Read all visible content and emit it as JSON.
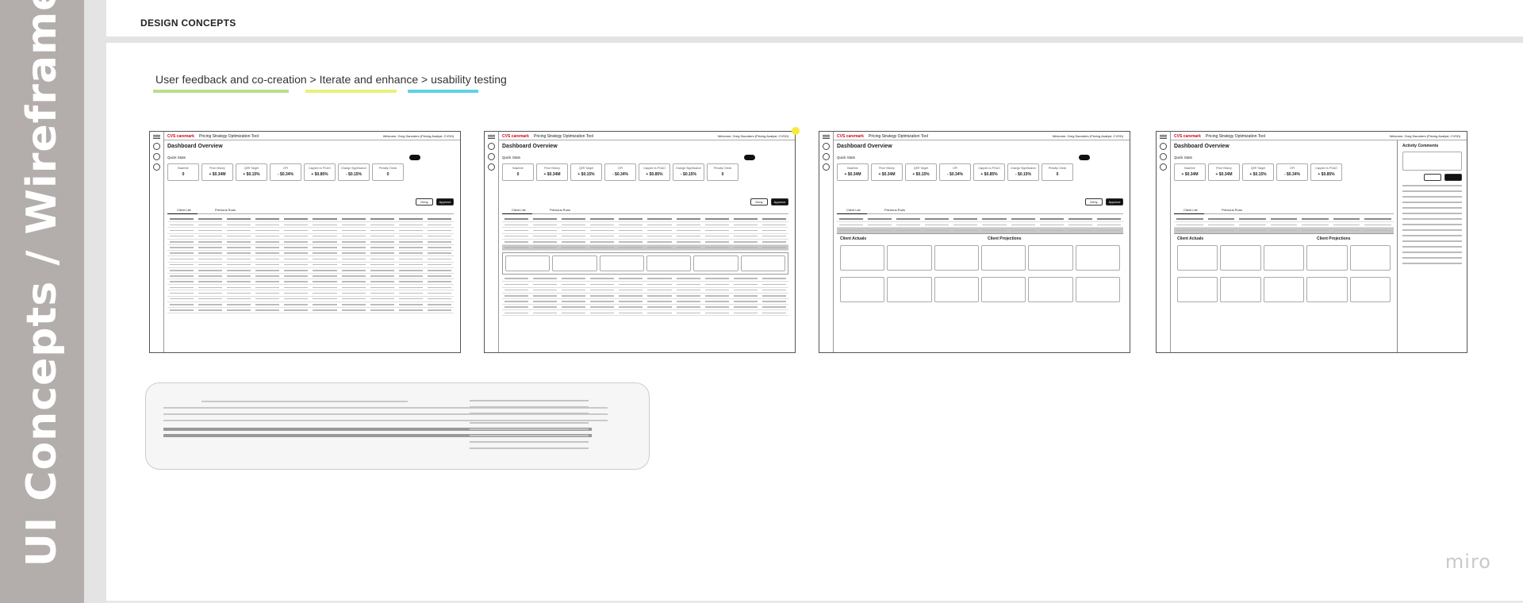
{
  "sidebar": {
    "title": "UI Concepts / Wireframes"
  },
  "header": {
    "title": "DESIGN CONCEPTS"
  },
  "process": {
    "text": "User feedback and co-creation > Iterate and enhance > usability testing",
    "colors": [
      "#b7e08a",
      "#e8f07a",
      "#5fd2e6"
    ]
  },
  "wireframe": {
    "logo": "CVS caremark",
    "app_title": "Pricing Strategy Optimization Tool",
    "welcome": "Welcome, Greg Saunders (Pricing Analyst, CVSH)",
    "dashboard_title": "Dashboard Overview",
    "quick_stats": "Quick Stats",
    "cards": [
      {
        "label": "Baseline",
        "value": "0"
      },
      {
        "label": "Price History",
        "value": "+ $0.34M"
      },
      {
        "label": "QER Target",
        "value": "+ $0.15%"
      },
      {
        "label": "GPI",
        "value": "- $0.34%"
      },
      {
        "label": "Capped vs PGAO",
        "value": "+ $0.85%"
      },
      {
        "label": "Change Significance",
        "value": "- $0.15%"
      },
      {
        "label": "Penalty Check",
        "value": "0"
      }
    ],
    "deny": "Deny",
    "approve": "Approve",
    "tab_client_list": "Client List",
    "tab_previous": "Previous Runs",
    "panel_actuals": "Client Actuals",
    "panel_projections": "Client Projections",
    "activity_title": "Activity Comments"
  },
  "brand": {
    "name": "miro"
  }
}
